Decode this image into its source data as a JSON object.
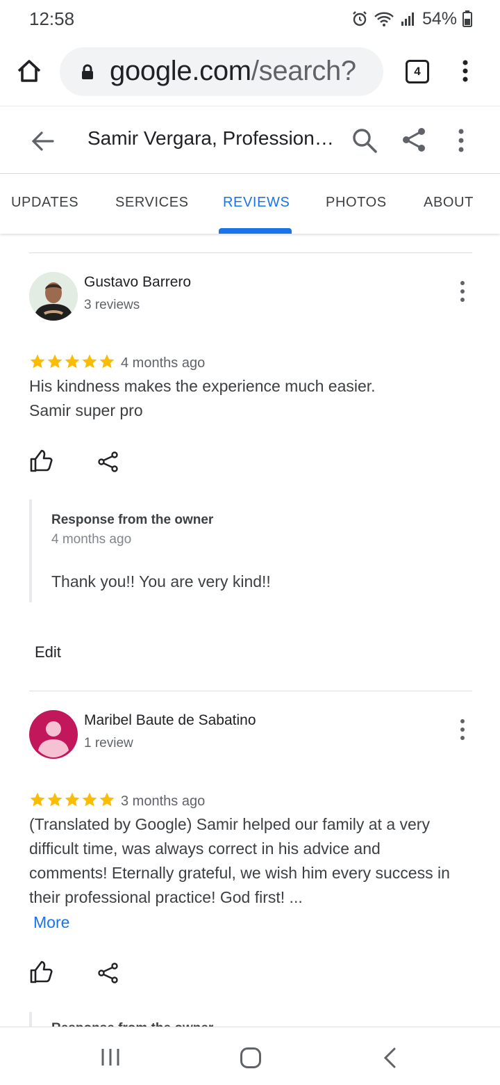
{
  "status": {
    "time": "12:58",
    "battery": "54%"
  },
  "browser": {
    "url_main": "google.com",
    "url_rest": "/search?",
    "tab_count": "4"
  },
  "header": {
    "title": "Samir Vergara, Professional Immigration..."
  },
  "tabs": [
    "UPDATES",
    "SERVICES",
    "REVIEWS",
    "PHOTOS",
    "ABOUT"
  ],
  "active_tab": "REVIEWS",
  "reviews": [
    {
      "name": "Gustavo Barrero",
      "count": "3 reviews",
      "rating": 5,
      "date": "4 months ago",
      "text": "His kindness makes the experience much easier. Samir super pro",
      "owner_title": "Response from the owner",
      "owner_date": "4 months ago",
      "owner_text": "Thank you!! You are very kind!!",
      "edit": "Edit"
    },
    {
      "name": "Maribel Baute de Sabatino",
      "count": "1 review",
      "rating": 5,
      "date": "3 months ago",
      "text": "(Translated by Google) Samir helped our family at a very difficult time, was always correct in his advice and comments! Eternally grateful, we wish him every success in their professional practice! God first! ...",
      "more": "More",
      "owner_title": "Response from the owner"
    }
  ],
  "colors": {
    "accent": "#1a73e8",
    "star": "#fbbc04",
    "avatar2": "#c2185b"
  }
}
